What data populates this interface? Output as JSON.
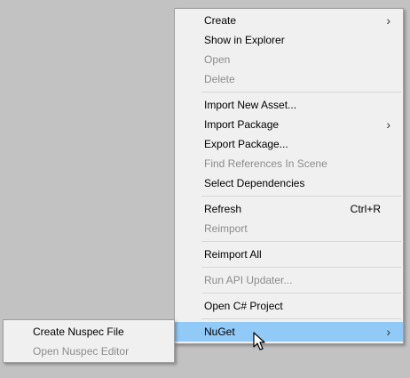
{
  "main_menu": {
    "items": [
      {
        "label": "Create",
        "arrow": "›"
      },
      {
        "label": "Show in Explorer"
      },
      {
        "label": "Open"
      },
      {
        "label": "Delete"
      },
      {
        "label": "Import New Asset..."
      },
      {
        "label": "Import Package",
        "arrow": "›"
      },
      {
        "label": "Export Package..."
      },
      {
        "label": "Find References In Scene"
      },
      {
        "label": "Select Dependencies"
      },
      {
        "label": "Refresh",
        "shortcut": "Ctrl+R"
      },
      {
        "label": "Reimport"
      },
      {
        "label": "Reimport All"
      },
      {
        "label": "Run API Updater..."
      },
      {
        "label": "Open C# Project"
      },
      {
        "label": "NuGet",
        "arrow": "›"
      }
    ]
  },
  "sub_menu": {
    "items": [
      {
        "label": "Create Nuspec File"
      },
      {
        "label": "Open Nuspec Editor"
      }
    ]
  },
  "colors": {
    "background": "#c2c2c2",
    "menu": "#f0f0f0",
    "highlight": "#91c9f7",
    "disabled_text": "#8c8c8c"
  },
  "icons": {
    "submenu_arrow": "chevron-right-icon",
    "pointer": "mouse-cursor-icon"
  }
}
